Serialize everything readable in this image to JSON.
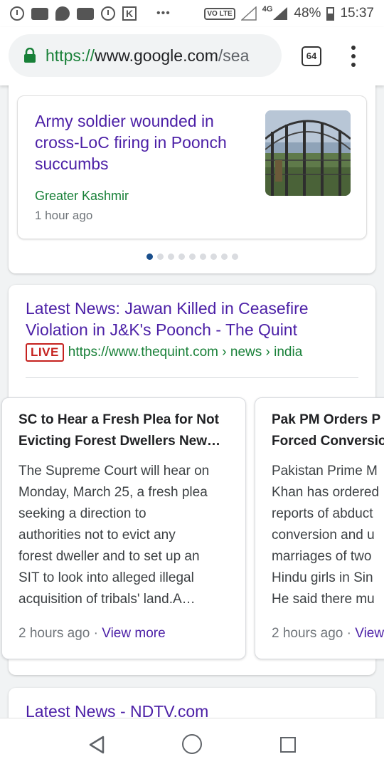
{
  "status_bar": {
    "battery": "48%",
    "time": "15:37",
    "network": "4G",
    "volte_label": "VO LTE",
    "more_label": "•••"
  },
  "browser": {
    "url_scheme": "https://",
    "url_host": "www.google.com",
    "url_path": "/sea",
    "tab_count": "64"
  },
  "top_story": {
    "title": "Army soldier wounded in cross-LoC firing in Poonch succumbs",
    "source": "Greater Kashmir",
    "time": "1 hour ago",
    "pager_count": 9,
    "pager_active": 0
  },
  "result": {
    "title": "Latest News: Jawan Killed in Ceasefire Violation in J&K's Poonch - The Quint",
    "badge": "LIVE",
    "cite": "https://www.thequint.com › news › india"
  },
  "news_cards": [
    {
      "title_lines": [
        "SC to Hear a Fresh Plea for Not",
        "Evicting Forest Dwellers New…"
      ],
      "body_lines": [
        "The Supreme Court will hear on",
        "Monday, March 25, a fresh plea",
        "seeking a direction to",
        "authorities not to evict any",
        "forest dweller and to set up an",
        "SIT to look into alleged illegal",
        "acquisition of tribals' land.A…"
      ],
      "time": "2 hours ago",
      "sep": " · ",
      "more": "View more"
    },
    {
      "title_lines": [
        "Pak PM Orders P",
        "Forced Conversio"
      ],
      "body_lines": [
        "Pakistan Prime M",
        "Khan has ordered",
        "reports of abduct",
        "conversion and u",
        "marriages of two",
        "Hindu girls in Sin",
        "He said there mu"
      ],
      "time": "2 hours ago",
      "sep": " · ",
      "more": "View"
    }
  ],
  "next_result": {
    "title": "Latest News - NDTV.com"
  }
}
